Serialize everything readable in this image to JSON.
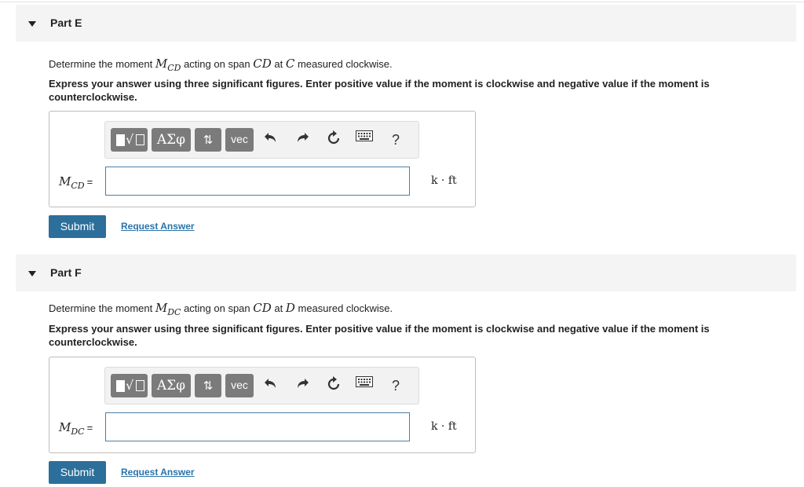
{
  "parts": [
    {
      "title": "Part E",
      "question": {
        "prefix": "Determine the moment ",
        "var_main": "M",
        "var_sub": "CD",
        "mid": " acting on span ",
        "span": "CD",
        "at": " at ",
        "point": "C",
        "suffix": " measured clockwise."
      },
      "instructions": "Express your answer using three significant figures. Enter positive value if the moment is clockwise and negative value if the moment is counterclockwise.",
      "answer": {
        "label_main": "M",
        "label_sub": "CD",
        "equals": "=",
        "value": "",
        "unit": "k · ft"
      },
      "submit_label": "Submit",
      "request_label": "Request Answer"
    },
    {
      "title": "Part F",
      "question": {
        "prefix": "Determine the moment ",
        "var_main": "M",
        "var_sub": "DC",
        "mid": " acting on span ",
        "span": "CD",
        "at": " at ",
        "point": "D",
        "suffix": " measured clockwise."
      },
      "instructions": "Express your answer using three significant figures. Enter positive value if the moment is clockwise and negative value if the moment is counterclockwise.",
      "answer": {
        "label_main": "M",
        "label_sub": "DC",
        "equals": "=",
        "value": "",
        "unit": "k · ft"
      },
      "submit_label": "Submit",
      "request_label": "Request Answer"
    }
  ],
  "toolbar": {
    "templates_sqrt": "√",
    "greek_label": "ΑΣφ",
    "arrows_label": "⇅",
    "vec_label": "vec",
    "help_label": "?",
    "icons": [
      "templates-icon",
      "undo-icon",
      "redo-icon",
      "reset-icon",
      "keyboard-icon",
      "help-icon"
    ]
  }
}
